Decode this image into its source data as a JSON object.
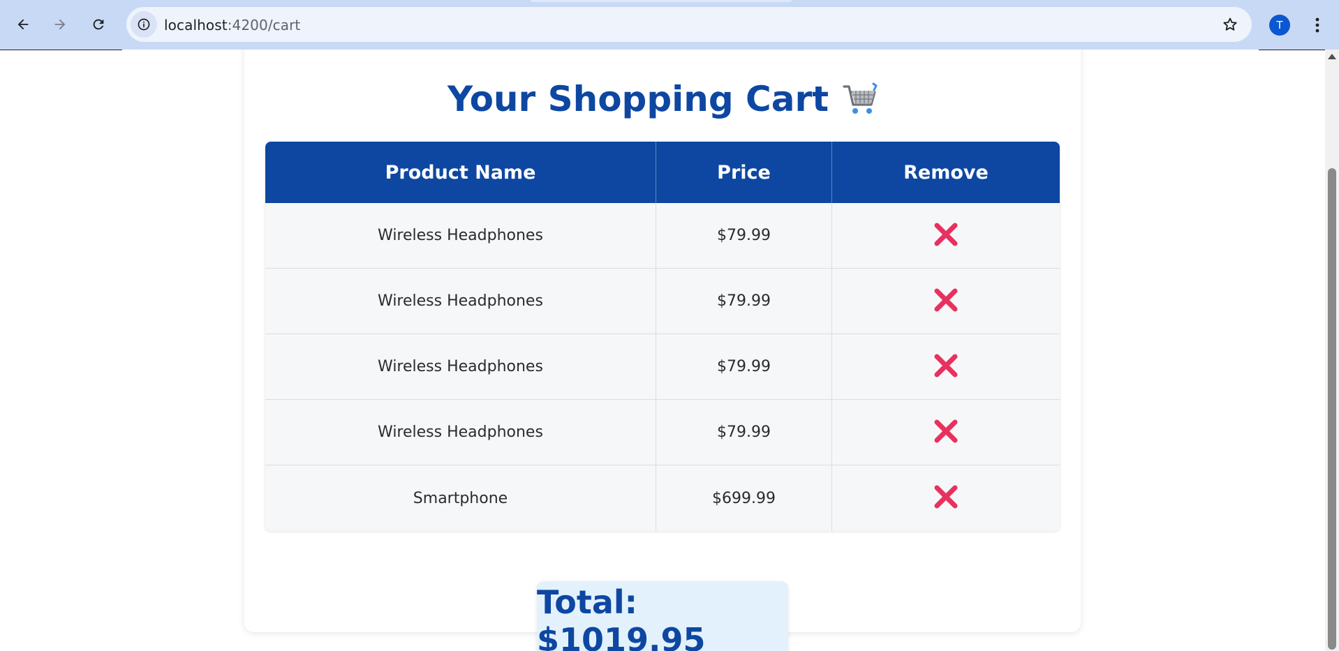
{
  "browser": {
    "url_host": "localhost",
    "url_path": ":4200/cart",
    "profile_initial": "T",
    "icons": {
      "back": "arrow-left-icon",
      "forward": "arrow-right-icon",
      "reload": "reload-icon",
      "site_info": "info-icon",
      "bookmark": "star-icon",
      "menu": "kebab-menu-icon"
    }
  },
  "page": {
    "title": "Your Shopping Cart",
    "title_icon": "shopping-cart-icon",
    "table": {
      "headers": [
        "Product Name",
        "Price",
        "Remove"
      ],
      "rows": [
        {
          "name": "Wireless Headphones",
          "price": "$79.99"
        },
        {
          "name": "Wireless Headphones",
          "price": "$79.99"
        },
        {
          "name": "Wireless Headphones",
          "price": "$79.99"
        },
        {
          "name": "Wireless Headphones",
          "price": "$79.99"
        },
        {
          "name": "Smartphone",
          "price": "$699.99"
        }
      ],
      "remove_icon": "cross-mark-icon"
    },
    "total": "Total: $1019.95"
  },
  "colors": {
    "chrome_bg": "#c8d9f5",
    "accent": "#0d47a1",
    "remove": "#e8315f",
    "total_bg": "#e3f1fd"
  }
}
